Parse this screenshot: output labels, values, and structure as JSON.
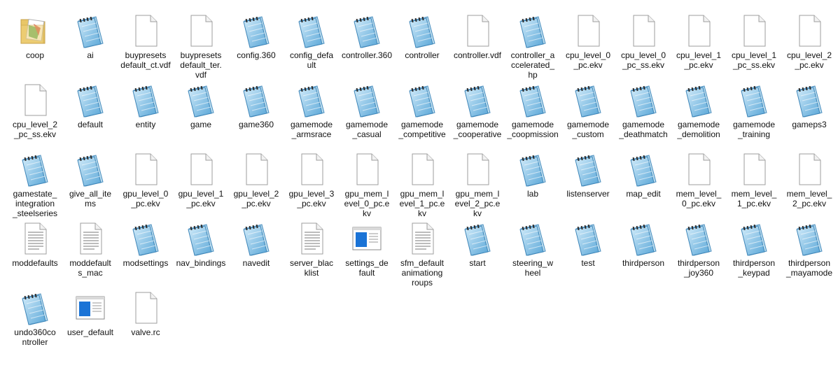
{
  "items": [
    {
      "label": "coop",
      "icon": "folder-icon"
    },
    {
      "label": "ai",
      "icon": "notepad-icon"
    },
    {
      "label": "buypresets​default_ct.v​df",
      "icon": "blank-file-icon"
    },
    {
      "label": "buypresets​default_ter.​vdf",
      "icon": "blank-file-icon"
    },
    {
      "label": "config.360",
      "icon": "notepad-icon"
    },
    {
      "label": "config_defa​ult",
      "icon": "notepad-icon"
    },
    {
      "label": "controller.3​60",
      "icon": "notepad-icon"
    },
    {
      "label": "controller",
      "icon": "notepad-icon"
    },
    {
      "label": "controller.v​df",
      "icon": "blank-file-icon"
    },
    {
      "label": "controller_a​ccelerated_​hp",
      "icon": "notepad-icon"
    },
    {
      "label": "cpu_level_0​_pc.ekv",
      "icon": "blank-file-icon"
    },
    {
      "label": "cpu_level_0​_pc_ss.ekv",
      "icon": "blank-file-icon"
    },
    {
      "label": "cpu_level_1​_pc.ekv",
      "icon": "blank-file-icon"
    },
    {
      "label": "cpu_level_1​_pc_ss.ekv",
      "icon": "blank-file-icon"
    },
    {
      "label": "cpu_level_2​_pc.ekv",
      "icon": "blank-file-icon"
    },
    {
      "label": "cpu_level_2​_pc_ss.ekv",
      "icon": "blank-file-icon"
    },
    {
      "label": "default",
      "icon": "notepad-icon"
    },
    {
      "label": "entity",
      "icon": "notepad-icon"
    },
    {
      "label": "game",
      "icon": "notepad-icon"
    },
    {
      "label": "game360",
      "icon": "notepad-icon"
    },
    {
      "label": "gamemode​_armsrace",
      "icon": "notepad-icon"
    },
    {
      "label": "gamemode​_casual",
      "icon": "notepad-icon"
    },
    {
      "label": "gamemode​_competitiv​e",
      "icon": "notepad-icon"
    },
    {
      "label": "gamemode​_cooperativ​e",
      "icon": "notepad-icon"
    },
    {
      "label": "gamemode​_coopmissi​on",
      "icon": "notepad-icon"
    },
    {
      "label": "gamemode​_custom",
      "icon": "notepad-icon"
    },
    {
      "label": "gamemode​_deathmatc​h",
      "icon": "notepad-icon"
    },
    {
      "label": "gamemode​_demolitio​n",
      "icon": "notepad-icon"
    },
    {
      "label": "gamemode​_training",
      "icon": "notepad-icon"
    },
    {
      "label": "gameps3",
      "icon": "notepad-icon"
    },
    {
      "label": "gamestate_​integration​_steelseries",
      "icon": "notepad-icon"
    },
    {
      "label": "give_all_ite​ms",
      "icon": "notepad-icon"
    },
    {
      "label": "gpu_level_0​_pc.ekv",
      "icon": "blank-file-icon"
    },
    {
      "label": "gpu_level_1​_pc.ekv",
      "icon": "blank-file-icon"
    },
    {
      "label": "gpu_level_2​_pc.ekv",
      "icon": "blank-file-icon"
    },
    {
      "label": "gpu_level_3​_pc.ekv",
      "icon": "blank-file-icon"
    },
    {
      "label": "gpu_mem_l​evel_0_pc.e​kv",
      "icon": "blank-file-icon"
    },
    {
      "label": "gpu_mem_l​evel_1_pc.e​kv",
      "icon": "blank-file-icon"
    },
    {
      "label": "gpu_mem_l​evel_2_pc.e​kv",
      "icon": "blank-file-icon"
    },
    {
      "label": "lab",
      "icon": "notepad-icon"
    },
    {
      "label": "listenserver",
      "icon": "notepad-icon"
    },
    {
      "label": "map_edit",
      "icon": "notepad-icon"
    },
    {
      "label": "mem_level_​0_pc.ekv",
      "icon": "blank-file-icon"
    },
    {
      "label": "mem_level_​1_pc.ekv",
      "icon": "blank-file-icon"
    },
    {
      "label": "mem_level_​2_pc.ekv",
      "icon": "blank-file-icon"
    },
    {
      "label": "moddefault​s",
      "icon": "text-file-icon"
    },
    {
      "label": "moddefault​s_mac",
      "icon": "text-file-icon"
    },
    {
      "label": "modsetting​s",
      "icon": "notepad-icon"
    },
    {
      "label": "nav_bindin​gs",
      "icon": "notepad-icon"
    },
    {
      "label": "navedit",
      "icon": "notepad-icon"
    },
    {
      "label": "server_blac​klist",
      "icon": "text-file-icon"
    },
    {
      "label": "settings_de​fault",
      "icon": "window-settings-icon"
    },
    {
      "label": "sfm_default​animationg​roups",
      "icon": "text-file-icon"
    },
    {
      "label": "start",
      "icon": "notepad-icon"
    },
    {
      "label": "steering_w​heel",
      "icon": "notepad-icon"
    },
    {
      "label": "test",
      "icon": "notepad-icon"
    },
    {
      "label": "thirdperson",
      "icon": "notepad-icon"
    },
    {
      "label": "thirdperson​_joy360",
      "icon": "notepad-icon"
    },
    {
      "label": "thirdperson​_keypad",
      "icon": "notepad-icon"
    },
    {
      "label": "thirdperson​_mayamod​e",
      "icon": "notepad-icon"
    },
    {
      "label": "undo360co​ntroller",
      "icon": "notepad-icon"
    },
    {
      "label": "user_defaul​t",
      "icon": "window-settings-icon"
    },
    {
      "label": "valve.rc",
      "icon": "blank-file-icon"
    }
  ],
  "colors": {
    "notepad_blue": "#5aa7d8",
    "notepad_light": "#d3ecfa",
    "window_blue": "#1a73d6",
    "file_border": "#9e9e9e",
    "label": "#111111"
  }
}
